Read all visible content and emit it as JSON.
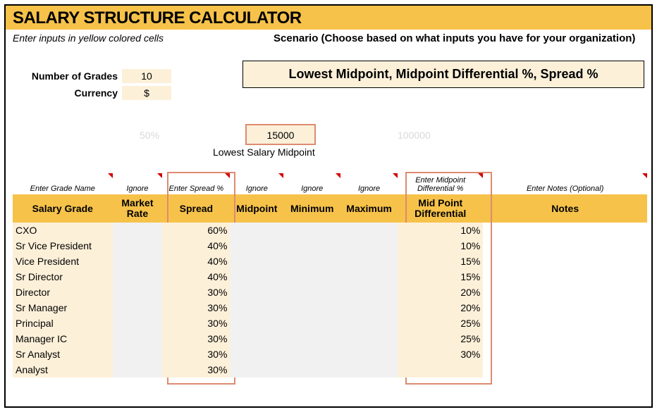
{
  "title": "SALARY STRUCTURE CALCULATOR",
  "sub_left": "Enter inputs in yellow colored cells",
  "sub_right": "Scenario (Choose based on what inputs you have for your organization)",
  "scenario_value": "Lowest Midpoint, Midpoint Differential %, Spread %",
  "inputs": {
    "grades_label": "Number of Grades",
    "grades_value": "10",
    "currency_label": "Currency",
    "currency_value": "$"
  },
  "midrow": {
    "ghost1": "50%",
    "lowest_value": "15000",
    "lowest_label": "Lowest Salary Midpoint",
    "ghost2": "100000"
  },
  "hints": {
    "grade": "Enter Grade Name",
    "market": "Ignore",
    "spread": "Enter Spread %",
    "midpoint": "Ignore",
    "minimum": "Ignore",
    "maximum": "Ignore",
    "diff": "Enter Midpoint Differential %",
    "notes": "Enter Notes (Optional)"
  },
  "headers": {
    "grade": "Salary Grade",
    "market": "Market Rate",
    "spread": "Spread",
    "midpoint": "Midpoint",
    "minimum": "Minimum",
    "maximum": "Maximum",
    "diff": "Mid Point Differential",
    "notes": "Notes"
  },
  "rows": [
    {
      "grade": "CXO",
      "spread": "60%",
      "diff": "10%"
    },
    {
      "grade": "Sr Vice President",
      "spread": "40%",
      "diff": "10%"
    },
    {
      "grade": "Vice President",
      "spread": "40%",
      "diff": "15%"
    },
    {
      "grade": "Sr Director",
      "spread": "40%",
      "diff": "15%"
    },
    {
      "grade": "Director",
      "spread": "30%",
      "diff": "20%"
    },
    {
      "grade": "Sr Manager",
      "spread": "30%",
      "diff": "20%"
    },
    {
      "grade": "Principal",
      "spread": "30%",
      "diff": "25%"
    },
    {
      "grade": "Manager IC",
      "spread": "30%",
      "diff": "25%"
    },
    {
      "grade": "Sr Analyst",
      "spread": "30%",
      "diff": "30%"
    },
    {
      "grade": "Analyst",
      "spread": "30%",
      "diff": ""
    }
  ]
}
